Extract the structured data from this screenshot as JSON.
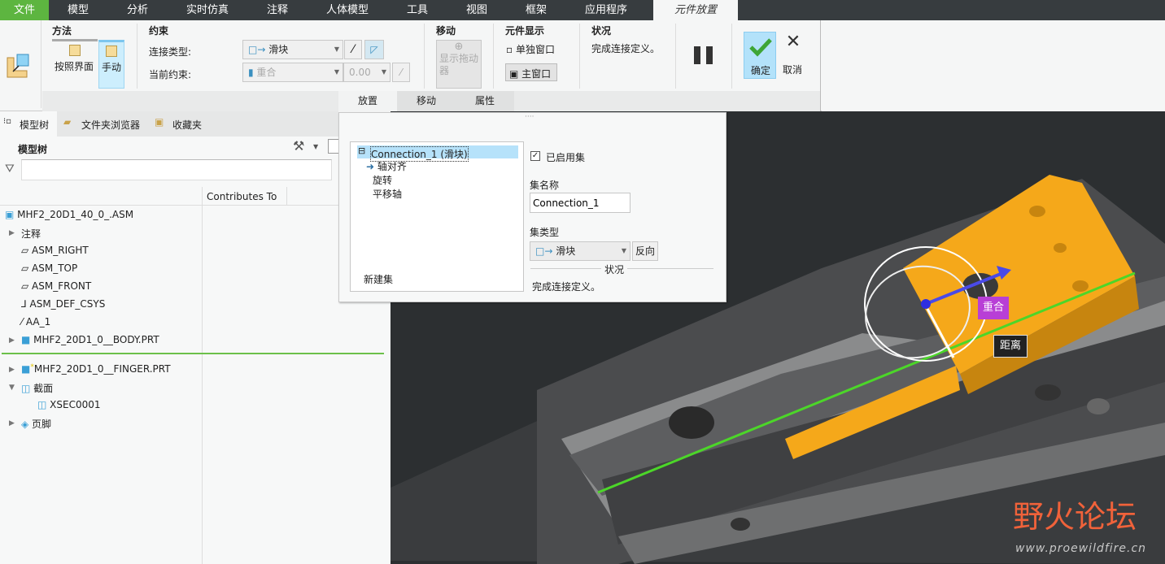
{
  "menubar": {
    "file": "文件",
    "items": [
      "模型",
      "分析",
      "实时仿真",
      "注释",
      "人体模型",
      "工具",
      "视图",
      "框架",
      "应用程序"
    ],
    "active_tab": "元件放置"
  },
  "ribbon": {
    "method": {
      "title": "方法",
      "by_interface": "按照界面",
      "manual": "手动"
    },
    "constraints": {
      "title": "约束",
      "connection_type_label": "连接类型:",
      "connection_type_value": "滑块",
      "current_constraint_label": "当前约束:",
      "current_constraint_value": "重合",
      "offset_value": "0.00"
    },
    "move": {
      "title": "移动",
      "show_dragger": "显示拖动器"
    },
    "component_display": {
      "title": "元件显示",
      "separate_window": "单独窗口",
      "main_window": "主窗口"
    },
    "status": {
      "title": "状况",
      "text": "完成连接定义。"
    },
    "ok": "确定",
    "cancel": "取消",
    "subtabs": [
      "放置",
      "移动",
      "属性"
    ]
  },
  "left_panel": {
    "tabs": [
      "模型树",
      "文件夹浏览器",
      "收藏夹"
    ],
    "header": "模型树",
    "filter_placeholder": "",
    "column": "Contributes To",
    "items": [
      {
        "label": "MHF2_20D1_40_0_.ASM"
      },
      {
        "label": "注释"
      },
      {
        "label": "ASM_RIGHT"
      },
      {
        "label": "ASM_TOP"
      },
      {
        "label": "ASM_FRONT"
      },
      {
        "label": "ASM_DEF_CSYS"
      },
      {
        "label": "AA_1"
      },
      {
        "label": "MHF2_20D1_0__BODY.PRT"
      },
      {
        "label": "MHF2_20D1_0__FINGER.PRT"
      },
      {
        "label": "截面"
      },
      {
        "label": "XSEC0001"
      },
      {
        "label": "页脚"
      }
    ]
  },
  "placement_panel": {
    "set_root": "Connection_1 (滑块)",
    "set_children": [
      "轴对齐",
      "旋转",
      "平移轴"
    ],
    "new_set": "新建集",
    "enabled_label": "已启用集",
    "enabled": true,
    "set_name_label": "集名称",
    "set_name_value": "Connection_1",
    "set_type_label": "集类型",
    "set_type_value": "滑块",
    "flip": "反向",
    "status_label": "状况",
    "status_text": "完成连接定义。"
  },
  "viewport": {
    "tag_coincident": "重合",
    "tag_distance": "距离",
    "watermark_cn": "野火论坛",
    "watermark_url": "www.proewildfire.cn"
  },
  "colors": {
    "file_tab": "#5db540",
    "menubar": "#373c3f",
    "accent_select": "#bde6fb",
    "part_orange": "#f5a81a",
    "axis_green": "#4cd629",
    "tag_purple": "#b83fd6"
  }
}
